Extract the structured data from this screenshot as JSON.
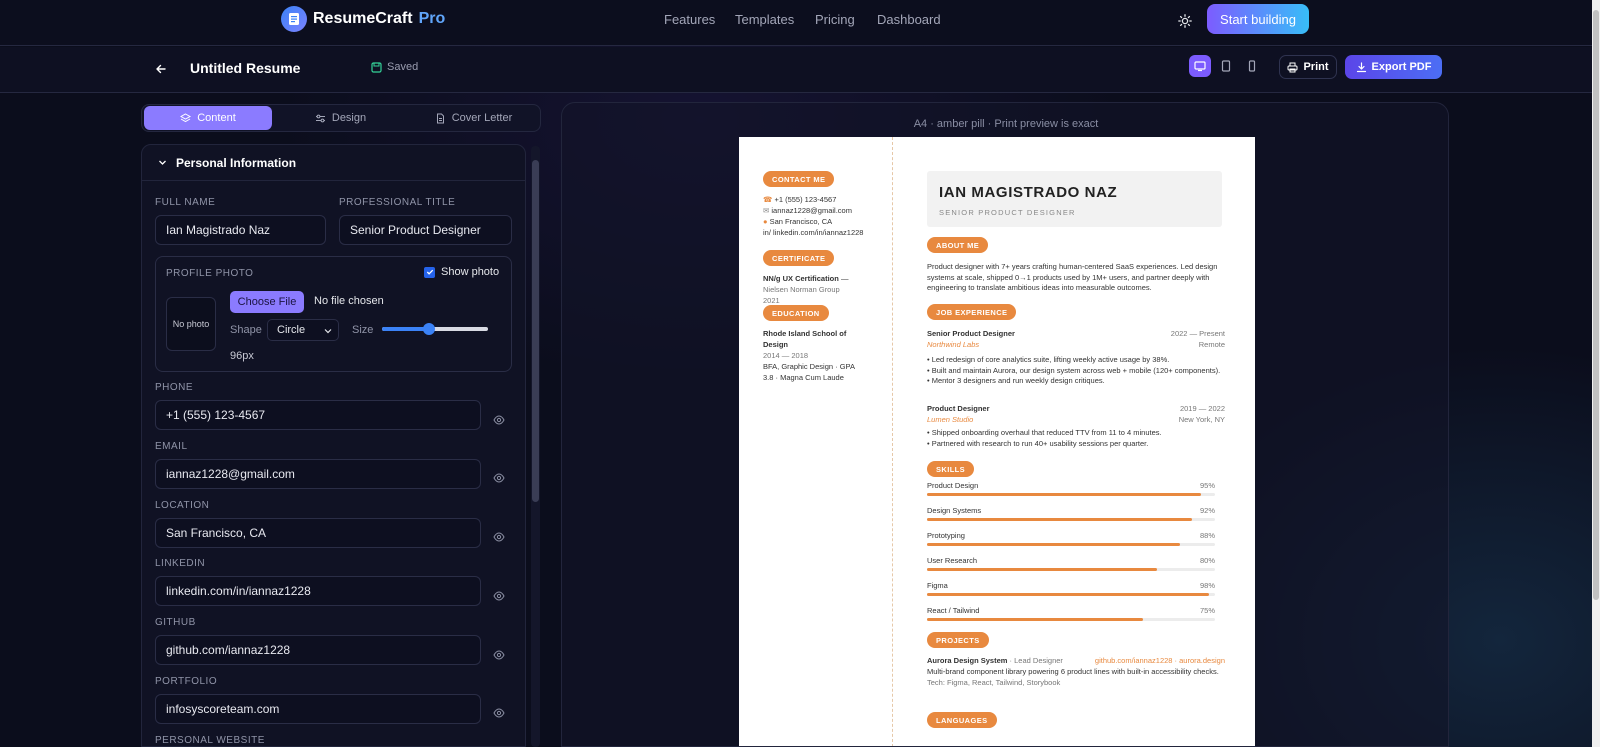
{
  "app": {
    "brand": "ResumeCraft",
    "brand_suffix": "Pro"
  },
  "nav": {
    "links": [
      "Features",
      "Templates",
      "Pricing",
      "Dashboard"
    ],
    "cta": "Start building"
  },
  "toolbar": {
    "title": "Untitled Resume",
    "status": "Saved",
    "print": "Print",
    "export": "Export PDF"
  },
  "tabs": [
    "Content",
    "Design",
    "Cover Letter"
  ],
  "editor": {
    "section_title": "Personal Information",
    "full_name_label": "FULL NAME",
    "full_name_value": "Ian Magistrado Naz",
    "title_label": "PROFESSIONAL TITLE",
    "title_value": "Senior Product Designer",
    "photo": {
      "label": "PROFILE PHOTO",
      "show_label": "Show photo",
      "show_checked": true,
      "no_photo": "No photo",
      "choose": "Choose File",
      "file_status": "No file chosen",
      "shape_label": "Shape",
      "shape_value": "Circle",
      "size_label": "Size",
      "size_value": "96px",
      "size_fraction": 0.44
    },
    "fields": [
      {
        "label": "PHONE",
        "value": "+1 (555) 123-4567"
      },
      {
        "label": "EMAIL",
        "value": "iannaz1228@gmail.com"
      },
      {
        "label": "LOCATION",
        "value": "San Francisco, CA"
      },
      {
        "label": "LINKEDIN",
        "value": "linkedin.com/in/iannaz1228"
      },
      {
        "label": "GITHUB",
        "value": "github.com/iannaz1228"
      },
      {
        "label": "PORTFOLIO",
        "value": "infosyscoreteam.com"
      }
    ],
    "next_label": "PERSONAL WEBSITE"
  },
  "preview": {
    "caption": "A4 · amber pill · Print preview is exact",
    "left": {
      "contact_pill": "CONTACT ME",
      "contacts": [
        "+1 (555) 123-4567",
        "iannaz1228@gmail.com",
        "San Francisco, CA",
        "in/ linkedin.com/in/iannaz1228"
      ],
      "certificate_pill": "CERTIFICATE",
      "cert_name": "NN/g UX Certification",
      "cert_dash": "—",
      "cert_org": "Nielsen Norman Group",
      "cert_year": "2021",
      "education_pill": "EDUCATION",
      "edu_school": "Rhode Island School of Design",
      "edu_years": "2014 — 2018",
      "edu_degree": "BFA, Graphic Design · GPA 3.8 · Magna Cum Laude"
    },
    "name": "IAN MAGISTRADO NAZ",
    "role": "SENIOR PRODUCT DESIGNER",
    "about_pill": "ABOUT ME",
    "about": "Product designer with 7+ years crafting human-centered SaaS experiences. Led design systems at scale, shipped 0→1 products used by 1M+ users, and partner deeply with engineering to translate ambitious ideas into measurable outcomes.",
    "job_pill": "JOB EXPERIENCE",
    "jobs": [
      {
        "title": "Senior Product Designer",
        "dates": "2022 — Present",
        "company": "Northwind Labs",
        "location": "Remote",
        "bullets": [
          "• Led redesign of core analytics suite, lifting weekly active usage by 38%.",
          "• Built and maintain Aurora, our design system across web + mobile (120+ components).",
          "• Mentor 3 designers and run weekly design critiques."
        ]
      },
      {
        "title": "Product Designer",
        "dates": "2019 — 2022",
        "company": "Lumen Studio",
        "location": "New York, NY",
        "bullets": [
          "• Shipped onboarding overhaul that reduced TTV from 11 to 4 minutes.",
          "• Partnered with research to run 40+ usability sessions per quarter."
        ]
      }
    ],
    "skills_pill": "SKILLS",
    "skills": [
      {
        "name": "Product Design",
        "pct": "95%",
        "value": 95
      },
      {
        "name": "Design Systems",
        "pct": "92%",
        "value": 92
      },
      {
        "name": "Prototyping",
        "pct": "88%",
        "value": 88
      },
      {
        "name": "User Research",
        "pct": "80%",
        "value": 80
      },
      {
        "name": "Figma",
        "pct": "98%",
        "value": 98
      },
      {
        "name": "React / Tailwind",
        "pct": "75%",
        "value": 75
      }
    ],
    "projects_pill": "PROJECTS",
    "project": {
      "name": "Aurora Design System",
      "role": "· Lead Designer",
      "links": "github.com/iannaz1228 · aurora.design",
      "desc": "Multi-brand component library powering 6 product lines with built-in accessibility checks.",
      "tech": "Tech: Figma, React, Tailwind, Storybook"
    },
    "languages_pill": "LANGUAGES"
  }
}
